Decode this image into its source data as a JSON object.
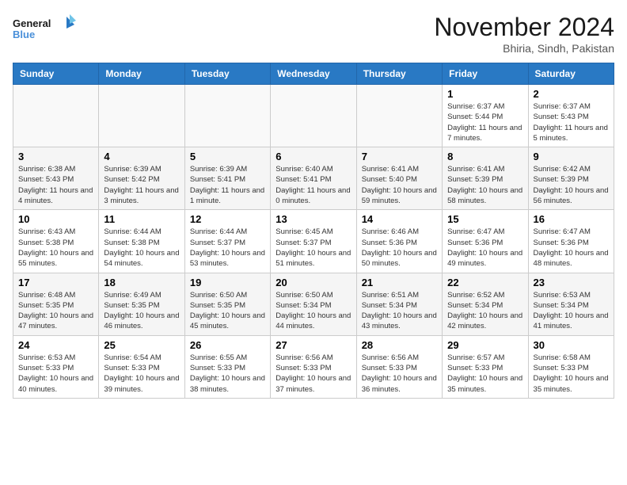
{
  "header": {
    "logo_line1": "General",
    "logo_line2": "Blue",
    "month": "November 2024",
    "location": "Bhiria, Sindh, Pakistan"
  },
  "days_of_week": [
    "Sunday",
    "Monday",
    "Tuesday",
    "Wednesday",
    "Thursday",
    "Friday",
    "Saturday"
  ],
  "weeks": [
    [
      {
        "day": "",
        "info": ""
      },
      {
        "day": "",
        "info": ""
      },
      {
        "day": "",
        "info": ""
      },
      {
        "day": "",
        "info": ""
      },
      {
        "day": "",
        "info": ""
      },
      {
        "day": "1",
        "info": "Sunrise: 6:37 AM\nSunset: 5:44 PM\nDaylight: 11 hours and 7 minutes."
      },
      {
        "day": "2",
        "info": "Sunrise: 6:37 AM\nSunset: 5:43 PM\nDaylight: 11 hours and 5 minutes."
      }
    ],
    [
      {
        "day": "3",
        "info": "Sunrise: 6:38 AM\nSunset: 5:43 PM\nDaylight: 11 hours and 4 minutes."
      },
      {
        "day": "4",
        "info": "Sunrise: 6:39 AM\nSunset: 5:42 PM\nDaylight: 11 hours and 3 minutes."
      },
      {
        "day": "5",
        "info": "Sunrise: 6:39 AM\nSunset: 5:41 PM\nDaylight: 11 hours and 1 minute."
      },
      {
        "day": "6",
        "info": "Sunrise: 6:40 AM\nSunset: 5:41 PM\nDaylight: 11 hours and 0 minutes."
      },
      {
        "day": "7",
        "info": "Sunrise: 6:41 AM\nSunset: 5:40 PM\nDaylight: 10 hours and 59 minutes."
      },
      {
        "day": "8",
        "info": "Sunrise: 6:41 AM\nSunset: 5:39 PM\nDaylight: 10 hours and 58 minutes."
      },
      {
        "day": "9",
        "info": "Sunrise: 6:42 AM\nSunset: 5:39 PM\nDaylight: 10 hours and 56 minutes."
      }
    ],
    [
      {
        "day": "10",
        "info": "Sunrise: 6:43 AM\nSunset: 5:38 PM\nDaylight: 10 hours and 55 minutes."
      },
      {
        "day": "11",
        "info": "Sunrise: 6:44 AM\nSunset: 5:38 PM\nDaylight: 10 hours and 54 minutes."
      },
      {
        "day": "12",
        "info": "Sunrise: 6:44 AM\nSunset: 5:37 PM\nDaylight: 10 hours and 53 minutes."
      },
      {
        "day": "13",
        "info": "Sunrise: 6:45 AM\nSunset: 5:37 PM\nDaylight: 10 hours and 51 minutes."
      },
      {
        "day": "14",
        "info": "Sunrise: 6:46 AM\nSunset: 5:36 PM\nDaylight: 10 hours and 50 minutes."
      },
      {
        "day": "15",
        "info": "Sunrise: 6:47 AM\nSunset: 5:36 PM\nDaylight: 10 hours and 49 minutes."
      },
      {
        "day": "16",
        "info": "Sunrise: 6:47 AM\nSunset: 5:36 PM\nDaylight: 10 hours and 48 minutes."
      }
    ],
    [
      {
        "day": "17",
        "info": "Sunrise: 6:48 AM\nSunset: 5:35 PM\nDaylight: 10 hours and 47 minutes."
      },
      {
        "day": "18",
        "info": "Sunrise: 6:49 AM\nSunset: 5:35 PM\nDaylight: 10 hours and 46 minutes."
      },
      {
        "day": "19",
        "info": "Sunrise: 6:50 AM\nSunset: 5:35 PM\nDaylight: 10 hours and 45 minutes."
      },
      {
        "day": "20",
        "info": "Sunrise: 6:50 AM\nSunset: 5:34 PM\nDaylight: 10 hours and 44 minutes."
      },
      {
        "day": "21",
        "info": "Sunrise: 6:51 AM\nSunset: 5:34 PM\nDaylight: 10 hours and 43 minutes."
      },
      {
        "day": "22",
        "info": "Sunrise: 6:52 AM\nSunset: 5:34 PM\nDaylight: 10 hours and 42 minutes."
      },
      {
        "day": "23",
        "info": "Sunrise: 6:53 AM\nSunset: 5:34 PM\nDaylight: 10 hours and 41 minutes."
      }
    ],
    [
      {
        "day": "24",
        "info": "Sunrise: 6:53 AM\nSunset: 5:33 PM\nDaylight: 10 hours and 40 minutes."
      },
      {
        "day": "25",
        "info": "Sunrise: 6:54 AM\nSunset: 5:33 PM\nDaylight: 10 hours and 39 minutes."
      },
      {
        "day": "26",
        "info": "Sunrise: 6:55 AM\nSunset: 5:33 PM\nDaylight: 10 hours and 38 minutes."
      },
      {
        "day": "27",
        "info": "Sunrise: 6:56 AM\nSunset: 5:33 PM\nDaylight: 10 hours and 37 minutes."
      },
      {
        "day": "28",
        "info": "Sunrise: 6:56 AM\nSunset: 5:33 PM\nDaylight: 10 hours and 36 minutes."
      },
      {
        "day": "29",
        "info": "Sunrise: 6:57 AM\nSunset: 5:33 PM\nDaylight: 10 hours and 35 minutes."
      },
      {
        "day": "30",
        "info": "Sunrise: 6:58 AM\nSunset: 5:33 PM\nDaylight: 10 hours and 35 minutes."
      }
    ]
  ]
}
